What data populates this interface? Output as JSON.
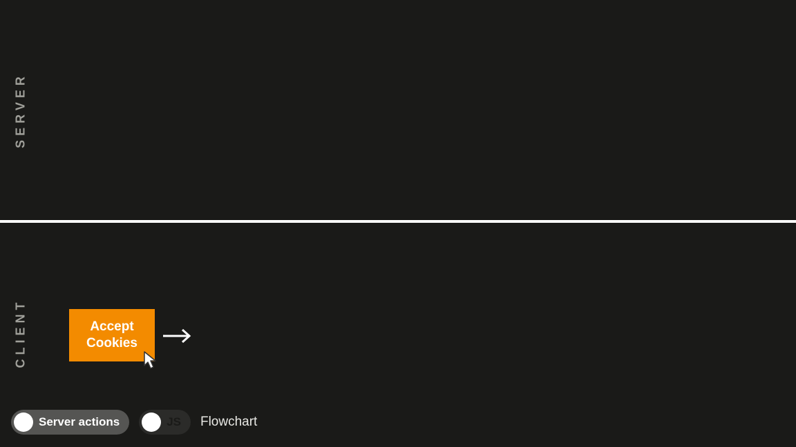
{
  "panels": {
    "server_label": "SERVER",
    "client_label": "CLIENT"
  },
  "client": {
    "accept_button_line1": "Accept",
    "accept_button_line2": "Cookies"
  },
  "controls": {
    "toggle_server_actions": {
      "label": "Server actions",
      "on": true
    },
    "toggle_js": {
      "label": "JS",
      "on": false
    },
    "flowchart_label": "Flowchart"
  },
  "icons": {
    "cursor": "cursor-icon",
    "arrow": "arrow-right-icon"
  }
}
